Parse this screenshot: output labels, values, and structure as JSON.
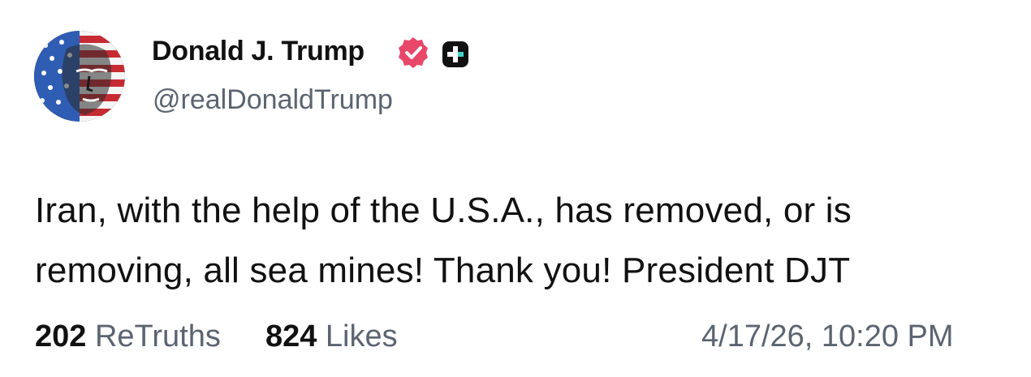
{
  "post": {
    "author": {
      "display_name": "Donald J. Trump",
      "handle": "@realDonaldTrump",
      "avatar_icon": "flag-portrait-avatar",
      "verified_icon": "verified-badge-icon",
      "plus_icon": "plus-badge-icon"
    },
    "body": "Iran, with the help of the U.S.A., has removed, or is removing, all sea mines! Thank you! President DJT",
    "stats": {
      "retruths_count": "202",
      "retruths_label": "ReTruths",
      "likes_count": "824",
      "likes_label": "Likes"
    },
    "timestamp": "4/17/26, 10:20 PM"
  },
  "colors": {
    "verified_badge": "#e8476a",
    "plus_badge": "#111111",
    "secondary_text": "#5b6470",
    "primary_text": "#111111"
  }
}
